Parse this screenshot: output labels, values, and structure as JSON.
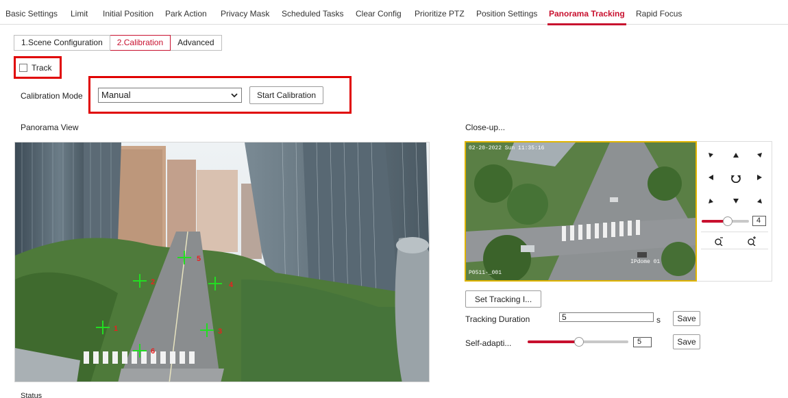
{
  "tabs": [
    {
      "label": "Basic Settings",
      "active": false
    },
    {
      "label": "Limit",
      "active": false
    },
    {
      "label": "Initial Position",
      "active": false
    },
    {
      "label": "Park Action",
      "active": false
    },
    {
      "label": "Privacy Mask",
      "active": false
    },
    {
      "label": "Scheduled Tasks",
      "active": false
    },
    {
      "label": "Clear Config",
      "active": false
    },
    {
      "label": "Prioritize PTZ",
      "active": false
    },
    {
      "label": "Position Settings",
      "active": false
    },
    {
      "label": "Panorama Tracking",
      "active": true
    },
    {
      "label": "Rapid Focus",
      "active": false
    }
  ],
  "steps": [
    {
      "label": "1.Scene Configuration",
      "active": false
    },
    {
      "label": "2.Calibration",
      "active": true
    },
    {
      "label": "Advanced",
      "active": false
    }
  ],
  "track": {
    "label": "Track",
    "checked": false
  },
  "calibration": {
    "mode_label": "Calibration Mode",
    "mode_value": "Manual",
    "start_button": "Start Calibration"
  },
  "panorama": {
    "title": "Panorama View",
    "markers": [
      "1",
      "2",
      "3",
      "4",
      "5",
      "6"
    ]
  },
  "closeup": {
    "title": "Close-up...",
    "osd_datetime": "02-20-2022 Sun 11:35:16",
    "osd_name": "IPdome 01",
    "osd_bottom": "P0511-_001"
  },
  "ptz": {
    "zoom_speed": "4"
  },
  "tracking": {
    "set_button": "Set Tracking I...",
    "duration_label": "Tracking Duration",
    "duration_value": "5",
    "duration_unit": "s",
    "save_label": "Save",
    "self_adapt_label": "Self-adapti...",
    "self_adapt_value": "5",
    "save2_label": "Save"
  },
  "status": {
    "label": "Status"
  },
  "colors": {
    "accent": "#c8102e",
    "highlight": "#e00000",
    "closeup_border": "#e0b400"
  }
}
